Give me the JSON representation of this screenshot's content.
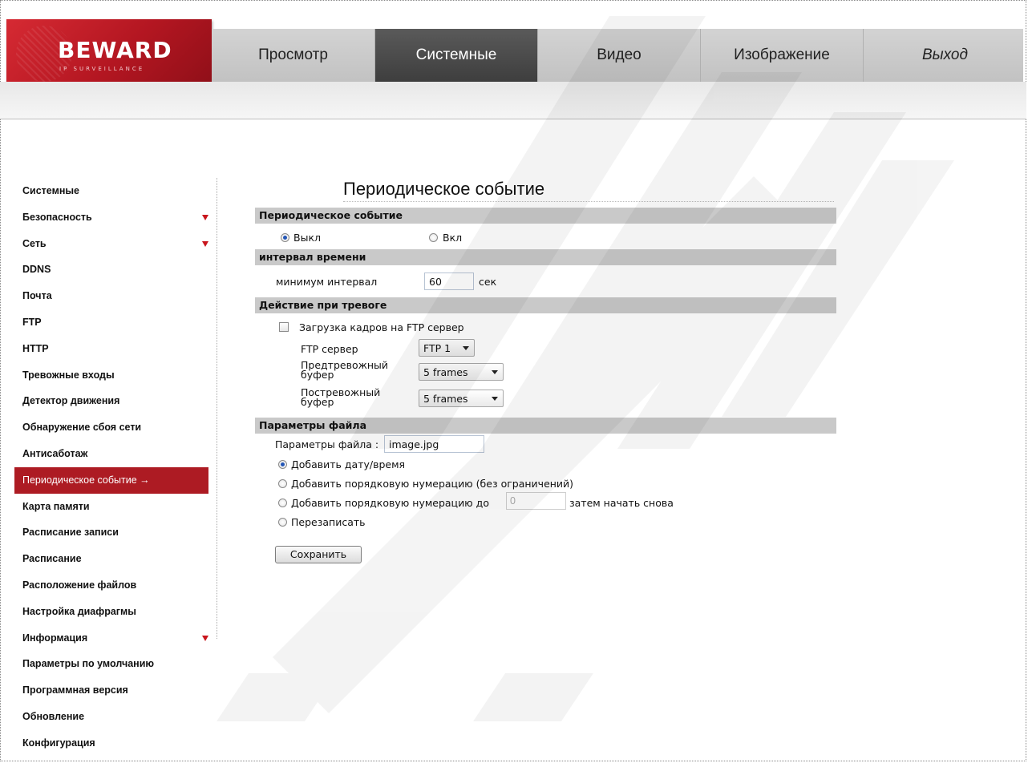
{
  "brand": {
    "name": "BEWARD",
    "tagline": "IP SURVEILLANCE",
    "accent": "#ad1b23"
  },
  "topnav": [
    {
      "label": "Просмотр",
      "active": false
    },
    {
      "label": "Системные",
      "active": true
    },
    {
      "label": "Видео",
      "active": false
    },
    {
      "label": "Изображение",
      "active": false
    },
    {
      "label": "Выход",
      "active": false
    }
  ],
  "sidebar": {
    "items": [
      {
        "label": "Системные"
      },
      {
        "label": "Безопасность",
        "expand": true
      },
      {
        "label": "Сеть",
        "expand": true
      },
      {
        "label": "DDNS"
      },
      {
        "label": "Почта"
      },
      {
        "label": "FTP"
      },
      {
        "label": "HTTP"
      },
      {
        "label": "Тревожные входы"
      },
      {
        "label": "Детектор движения"
      },
      {
        "label": "Обнаружение сбоя сети"
      },
      {
        "label": "Антисаботаж"
      },
      {
        "label": "Периодическое событие →",
        "active": true
      },
      {
        "label": "Карта памяти"
      },
      {
        "label": "Расписание записи"
      },
      {
        "label": "Расписание"
      },
      {
        "label": "Расположение файлов"
      },
      {
        "label": "Настройка диафрагмы"
      },
      {
        "label": "Информация",
        "expand": true
      },
      {
        "label": "Параметры по умолчанию"
      },
      {
        "label": "Программная версия"
      },
      {
        "label": "Обновление"
      },
      {
        "label": "Конфигурация"
      }
    ]
  },
  "main": {
    "title": "Периодическое событие",
    "sections": {
      "periodic": "Периодическое событие",
      "interval": "интервал времени",
      "action": "Действие при тревоге",
      "file": "Параметры файла"
    },
    "periodic": {
      "off_label": "Выкл",
      "on_label": "Вкл",
      "selected": "off"
    },
    "interval": {
      "label": "минимум интервал",
      "value": "60",
      "unit": "сек"
    },
    "action": {
      "ftp_upload_label": "Загрузка кадров на FTP сервер",
      "ftp_upload_checked": false,
      "ftp_server_label": "FTP сервер",
      "ftp_server_value": "FTP 1",
      "pre_buffer_label_1": "Предтревожный",
      "pre_buffer_label_2": "буфер",
      "pre_buffer_value": "5 frames",
      "post_buffer_label_1": "Постревожный",
      "post_buffer_label_2": "буфер",
      "post_buffer_value": "5 frames"
    },
    "file": {
      "name_label": "Параметры файла :",
      "name_value": "image.jpg",
      "opt_datetime": "Добавить дату/время",
      "opt_seq_unlimited": "Добавить порядковую нумерацию (без ограничений)",
      "opt_seq_until": "Добавить порядковую нумерацию до",
      "opt_seq_until_value": "0",
      "opt_seq_until_suffix": "затем начать снова",
      "opt_overwrite": "Перезаписать",
      "selected": "datetime"
    },
    "save_label": "Сохранить"
  }
}
